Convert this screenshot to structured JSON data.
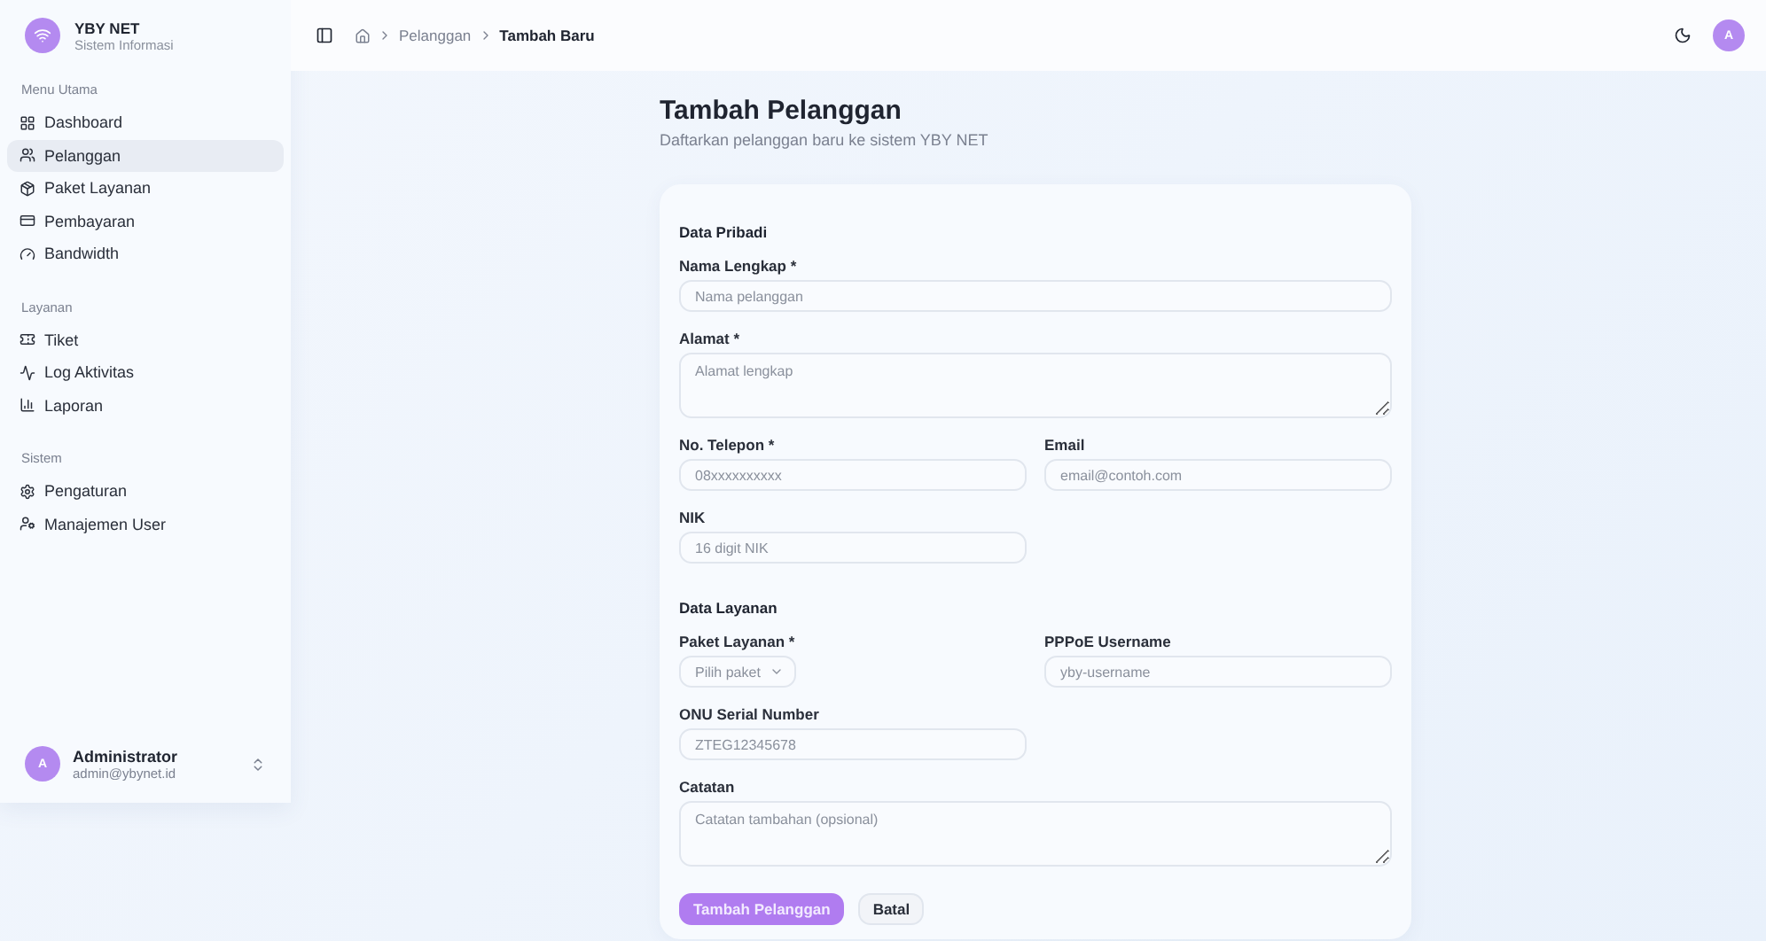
{
  "sidebar": {
    "brand": {
      "name": "YBY NET",
      "subtitle": "Sistem Informasi"
    },
    "groups": [
      {
        "title": "Menu Utama",
        "items": [
          {
            "label": "Dashboard",
            "selected": false
          },
          {
            "label": "Pelanggan",
            "selected": true
          },
          {
            "label": "Paket Layanan",
            "selected": false
          },
          {
            "label": "Pembayaran",
            "selected": false
          },
          {
            "label": "Bandwidth",
            "selected": false
          }
        ]
      },
      {
        "title": "Layanan",
        "items": [
          {
            "label": "Tiket",
            "selected": false
          },
          {
            "label": "Log Aktivitas",
            "selected": false
          },
          {
            "label": "Laporan",
            "selected": false
          }
        ]
      },
      {
        "title": "Sistem",
        "items": [
          {
            "label": "Pengaturan",
            "selected": false
          },
          {
            "label": "Manajemen User",
            "selected": false
          }
        ]
      }
    ],
    "user": {
      "initial": "A",
      "name": "Administrator",
      "email": "admin@ybynet.id"
    }
  },
  "header": {
    "breadcrumb": [
      "Pelanggan",
      "Tambah Baru"
    ],
    "avatar": "A"
  },
  "page": {
    "title": "Tambah Pelanggan",
    "subtitle": "Daftarkan pelanggan baru ke sistem YBY NET"
  },
  "form": {
    "sections": [
      {
        "title": "Data Pribadi",
        "fields": [
          {
            "kind": "input-wide",
            "label": "Nama Lengkap *",
            "placeholder": "Nama pelanggan"
          },
          {
            "kind": "textarea",
            "label": "Alamat *",
            "placeholder": "Alamat lengkap"
          },
          {
            "kind": "input",
            "label": "No. Telepon *",
            "placeholder": "08xxxxxxxxxx"
          },
          {
            "kind": "input",
            "label": "Email",
            "placeholder": "email@contoh.com"
          },
          {
            "kind": "input",
            "label": "NIK",
            "placeholder": "16 digit NIK"
          }
        ]
      },
      {
        "title": "Data Layanan",
        "fields": [
          {
            "kind": "select",
            "label": "Paket Layanan *",
            "placeholder": "Pilih paket"
          },
          {
            "kind": "input",
            "label": "PPPoE Username",
            "placeholder": "yby-username"
          },
          {
            "kind": "input",
            "label": "ONU Serial Number",
            "placeholder": "ZTEG12345678"
          },
          {
            "kind": "textarea",
            "label": "Catatan",
            "placeholder": "Catatan tambahan (opsional)"
          }
        ]
      }
    ],
    "buttons": [
      {
        "label": "Tambah Pelanggan",
        "kind": "primary"
      },
      {
        "label": "Batal",
        "kind": "secondary"
      }
    ]
  }
}
